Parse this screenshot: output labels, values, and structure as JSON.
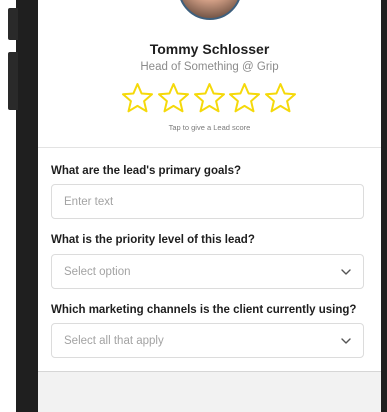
{
  "profile": {
    "name": "Tommy Schlosser",
    "role": "Head of Something @ Grip",
    "rating_hint": "Tap to give a Lead score",
    "rating": {
      "value": 0,
      "max": 5
    }
  },
  "colors": {
    "star_outline": "#f5d90a",
    "field_border": "#dcdcdc",
    "label_text": "#1e1e1e",
    "placeholder_text": "#a3a3a3"
  },
  "form": {
    "goals": {
      "label": "What are the lead's primary goals?",
      "placeholder": "Enter text"
    },
    "priority": {
      "label": "What is the priority level of this lead?",
      "placeholder": "Select option"
    },
    "channels": {
      "label": "Which marketing channels is the client currently using?",
      "placeholder": "Select all that apply"
    }
  },
  "icons": {
    "star": "star-outline-icon",
    "dropdown": "chevron-down-icon"
  }
}
